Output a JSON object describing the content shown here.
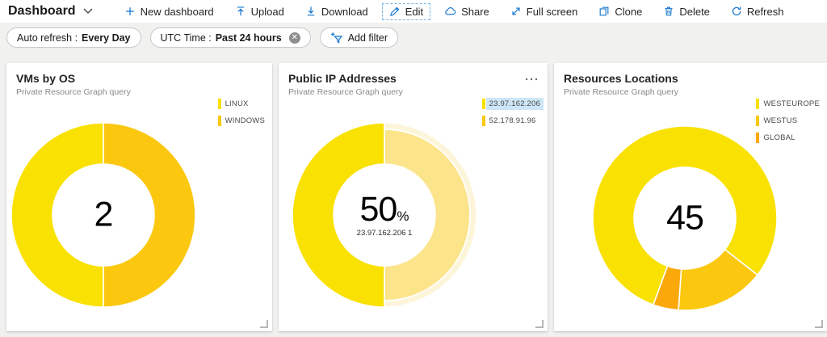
{
  "toolbar": {
    "title": "Dashboard",
    "items": [
      "New dashboard",
      "Upload",
      "Download",
      "Edit",
      "Share",
      "Full screen",
      "Clone",
      "Delete",
      "Refresh"
    ]
  },
  "filters": {
    "auto_refresh_label": "Auto refresh :",
    "auto_refresh_value": "Every Day",
    "utc_label": "UTC Time :",
    "utc_value": "Past 24 hours",
    "close_glyph": "✕",
    "add_filter": "Add filter"
  },
  "colors": {
    "accent_blue": "#1374cc",
    "selection_highlight": "#cde6f7",
    "yellow": "#f9e102",
    "amber": "#fbc80f",
    "orange": "#faa80a",
    "faded_amber": "#fbe48a",
    "faded_halo": "#fdf5da"
  },
  "cards": [
    {
      "title": "VMs by OS",
      "subtitle": "Private Resource Graph query",
      "legend": [
        {
          "label": "LINUX",
          "color": "#f9e102"
        },
        {
          "label": "WINDOWS",
          "color": "#fbc80f"
        }
      ]
    },
    {
      "title": "Public IP Addresses",
      "subtitle": "Private Resource Graph query",
      "legend": [
        {
          "label": "23.97.162.206",
          "color": "#f9e102",
          "selected": true
        },
        {
          "label": "52.178.91.96",
          "color": "#fbc80f"
        }
      ]
    },
    {
      "title": "Resources Locations",
      "subtitle": "Private Resource Graph query",
      "legend": [
        {
          "label": "WESTEUROPE",
          "color": "#f9e102"
        },
        {
          "label": "WESTUS",
          "color": "#fbc80f"
        },
        {
          "label": "GLOBAL",
          "color": "#faa80a"
        }
      ]
    }
  ],
  "chart_data": [
    {
      "type": "donut",
      "title": "VMs by OS",
      "start_angle": 180,
      "legend_position": "top-right",
      "slices": [
        {
          "label": "LINUX",
          "value": 1,
          "color": "#f9e102"
        },
        {
          "label": "WINDOWS",
          "value": 1,
          "color": "#fbc80f"
        }
      ],
      "center_label": "2"
    },
    {
      "type": "donut",
      "title": "Public IP Addresses",
      "start_angle": 180,
      "legend_position": "top-right",
      "slices": [
        {
          "label": "23.97.162.206",
          "value": 1,
          "color": "#f9e102",
          "selected": true
        },
        {
          "label": "52.178.91.96",
          "value": 1,
          "color": "#fbe48a",
          "halo": "#fdf5da",
          "shrink": 0.93,
          "faded": true
        }
      ],
      "center_label": "50",
      "center_unit": "%",
      "center_sub": "23.97.162.206 1"
    },
    {
      "type": "donut",
      "title": "Resources Locations",
      "start_angle": 200,
      "legend_position": "top-right",
      "slices": [
        {
          "label": "WESTEUROPE",
          "value": 36,
          "color": "#f9e102"
        },
        {
          "label": "WESTUS",
          "value": 7,
          "color": "#fbc80f"
        },
        {
          "label": "GLOBAL",
          "value": 2,
          "color": "#faa80a"
        }
      ],
      "center_label": "45"
    }
  ]
}
